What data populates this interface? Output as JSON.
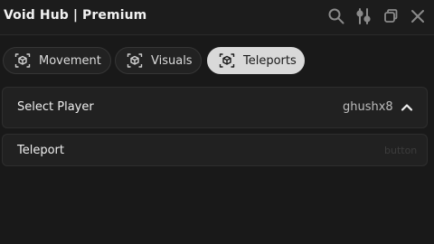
{
  "window": {
    "title": "Void Hub | Premium",
    "icons": [
      "search-icon",
      "sliders-icon",
      "restore-icon",
      "close-icon"
    ]
  },
  "tabs": [
    {
      "label": "Movement",
      "icon": "box-icon",
      "active": false
    },
    {
      "label": "Visuals",
      "icon": "box-icon",
      "active": false
    },
    {
      "label": "Teleports",
      "icon": "box-icon",
      "active": true
    }
  ],
  "content": {
    "select_player": {
      "label": "Select Player",
      "value": "ghushx8",
      "icon": "chevron-up-icon"
    },
    "teleport": {
      "label": "Teleport",
      "hint": "button"
    }
  },
  "colors": {
    "background": "#191919",
    "row": "#212121",
    "active_tab": "#d9d9d9",
    "text": "#f0f0f0"
  }
}
